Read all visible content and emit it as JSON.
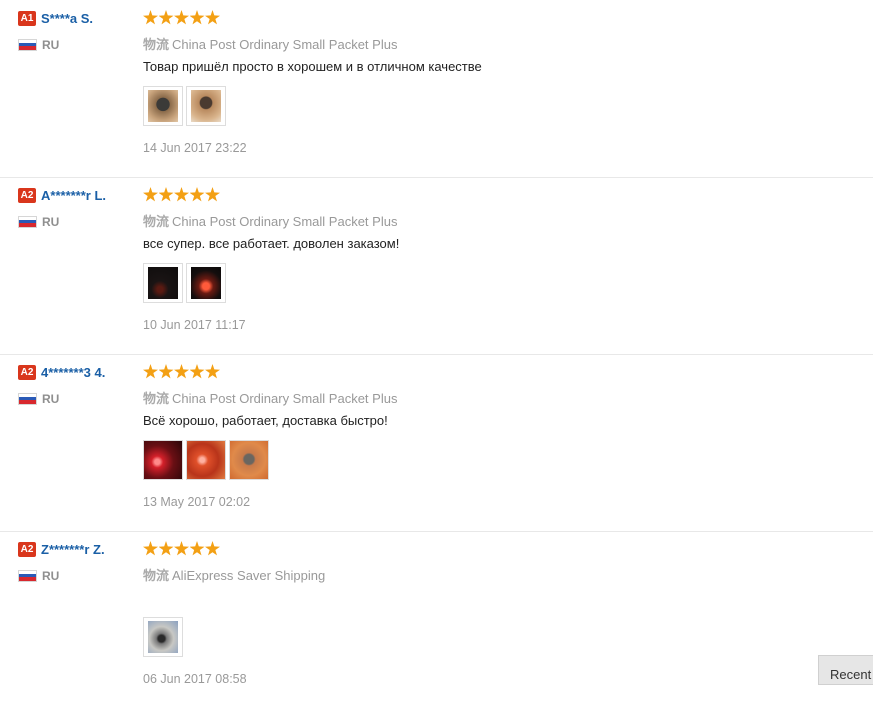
{
  "reviews": [
    {
      "level": "A1",
      "name": "S****a S.",
      "country": "RU",
      "stars": 5,
      "shipping_label": "物流",
      "shipping_method": "China Post Ordinary Small Packet Plus",
      "feedback": "Товар пришёл просто в хорошем и в отличном качестве",
      "photos": [
        "photo-stone-in-hand",
        "photo-stone-in-hand"
      ],
      "date": "14 Jun 2017 23:22"
    },
    {
      "level": "A2",
      "name": "A*******r L.",
      "country": "RU",
      "stars": 5,
      "shipping_label": "物流",
      "shipping_method": "China Post Ordinary Small Packet Plus",
      "feedback": "все супер. все работает. доволен заказом!",
      "photos": [
        "photo-dark-device",
        "photo-red-glow"
      ],
      "date": "10 Jun 2017 11:17"
    },
    {
      "level": "A2",
      "name": "4*******3 4.",
      "country": "RU",
      "stars": 5,
      "shipping_label": "物流",
      "shipping_method": "China Post Ordinary Small Packet Plus",
      "feedback": "Всё хорошо, работает, доставка быстро!",
      "photos": [
        "photo-red-light",
        "photo-red-light",
        "photo-stone-orange"
      ],
      "date": "13 May 2017 02:02"
    },
    {
      "level": "A2",
      "name": "Z*******r Z.",
      "country": "RU",
      "stars": 5,
      "shipping_label": "物流",
      "shipping_method": "AliExpress Saver Shipping",
      "feedback": "",
      "photos": [
        "photo-stone-blue"
      ],
      "date": "06 Jun 2017 08:58"
    }
  ],
  "recent_button": "Recent",
  "colors": {
    "badge": "#d9361c",
    "username": "#1a5fa6",
    "star": "#f3a014",
    "muted": "#999999"
  }
}
